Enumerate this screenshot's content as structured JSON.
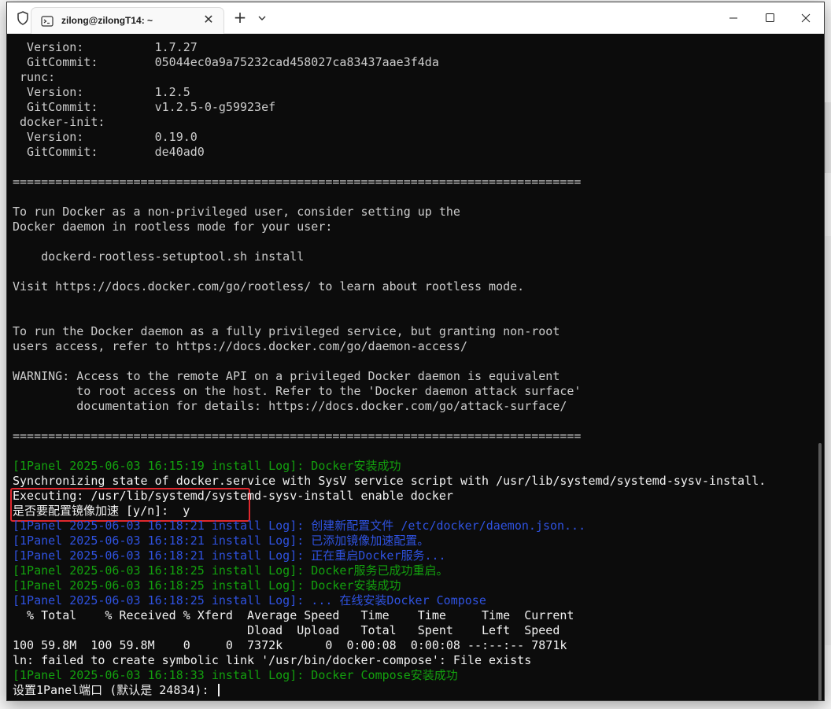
{
  "window": {
    "tab_title": "zilong@zilongT14: ~",
    "close_tab_symbol": "✕",
    "new_tab_symbol": "+",
    "icons": [
      "shield-icon",
      "terminal-icon",
      "chevron-down-icon",
      "minimize-icon",
      "maximize-icon",
      "close-icon"
    ]
  },
  "terminal": {
    "lines": [
      {
        "text": "  Version:          1.7.27",
        "color": "default"
      },
      {
        "text": "  GitCommit:        05044ec0a9a75232cad458027ca83437aae3f4da",
        "color": "default"
      },
      {
        "text": " runc:",
        "color": "default"
      },
      {
        "text": "  Version:          1.2.5",
        "color": "default"
      },
      {
        "text": "  GitCommit:        v1.2.5-0-g59923ef",
        "color": "default"
      },
      {
        "text": " docker-init:",
        "color": "default"
      },
      {
        "text": "  Version:          0.19.0",
        "color": "default"
      },
      {
        "text": "  GitCommit:        de40ad0",
        "color": "default"
      },
      {
        "text": "",
        "color": "default"
      },
      {
        "text": "================================================================================",
        "color": "default"
      },
      {
        "text": "",
        "color": "default"
      },
      {
        "text": "To run Docker as a non-privileged user, consider setting up the",
        "color": "default"
      },
      {
        "text": "Docker daemon in rootless mode for your user:",
        "color": "default"
      },
      {
        "text": "",
        "color": "default"
      },
      {
        "text": "    dockerd-rootless-setuptool.sh install",
        "color": "default"
      },
      {
        "text": "",
        "color": "default"
      },
      {
        "text": "Visit https://docs.docker.com/go/rootless/ to learn about rootless mode.",
        "color": "default"
      },
      {
        "text": "",
        "color": "default"
      },
      {
        "text": "",
        "color": "default"
      },
      {
        "text": "To run the Docker daemon as a fully privileged service, but granting non-root",
        "color": "default"
      },
      {
        "text": "users access, refer to https://docs.docker.com/go/daemon-access/",
        "color": "default"
      },
      {
        "text": "",
        "color": "default"
      },
      {
        "text": "WARNING: Access to the remote API on a privileged Docker daemon is equivalent",
        "color": "default"
      },
      {
        "text": "         to root access on the host. Refer to the 'Docker daemon attack surface'",
        "color": "default"
      },
      {
        "text": "         documentation for details: https://docs.docker.com/go/attack-surface/",
        "color": "default"
      },
      {
        "text": "",
        "color": "default"
      },
      {
        "text": "================================================================================",
        "color": "default"
      },
      {
        "text": "",
        "color": "default"
      },
      {
        "text": "[1Panel 2025-06-03 16:15:19 install Log]: Docker安装成功",
        "color": "green"
      },
      {
        "text": "Synchronizing state of docker.service with SysV service script with /usr/lib/systemd/systemd-sysv-install.",
        "color": "white"
      },
      {
        "text": "Executing: /usr/lib/systemd/systemd-sysv-install enable docker",
        "color": "white"
      },
      {
        "text": "是否要配置镜像加速 [y/n]:  y",
        "color": "white"
      },
      {
        "text": "[1Panel 2025-06-03 16:18:21 install Log]: 创建新配置文件 /etc/docker/daemon.json...",
        "color": "blue"
      },
      {
        "text": "[1Panel 2025-06-03 16:18:21 install Log]: 已添加镜像加速配置。",
        "color": "blue"
      },
      {
        "text": "[1Panel 2025-06-03 16:18:21 install Log]: 正在重启Docker服务...",
        "color": "blue"
      },
      {
        "text": "[1Panel 2025-06-03 16:18:25 install Log]: Docker服务已成功重启。",
        "color": "green"
      },
      {
        "text": "[1Panel 2025-06-03 16:18:25 install Log]: Docker安装成功",
        "color": "green"
      },
      {
        "text": "[1Panel 2025-06-03 16:18:25 install Log]: ... 在线安装Docker Compose",
        "color": "blue"
      },
      {
        "text": "  % Total    % Received % Xferd  Average Speed   Time    Time     Time  Current",
        "color": "white"
      },
      {
        "text": "                                 Dload  Upload   Total   Spent    Left  Speed",
        "color": "white"
      },
      {
        "text": "100 59.8M  100 59.8M    0     0  7372k      0  0:00:08  0:00:08 --:--:-- 7871k",
        "color": "white"
      },
      {
        "text": "ln: failed to create symbolic link '/usr/bin/docker-compose': File exists",
        "color": "white"
      },
      {
        "text": "[1Panel 2025-06-03 16:18:33 install Log]: Docker Compose安装成功",
        "color": "green"
      },
      {
        "text": "设置1Panel端口 (默认是 24834): ",
        "color": "white",
        "cursor": true
      }
    ]
  },
  "colors": {
    "terminal_bg": "#0c0c0c",
    "default_text": "#cccccc",
    "white_text": "#f2f2f2",
    "green_text": "#13a10e",
    "blue_text": "#2f52e0",
    "highlight_box": "#e0282e"
  }
}
